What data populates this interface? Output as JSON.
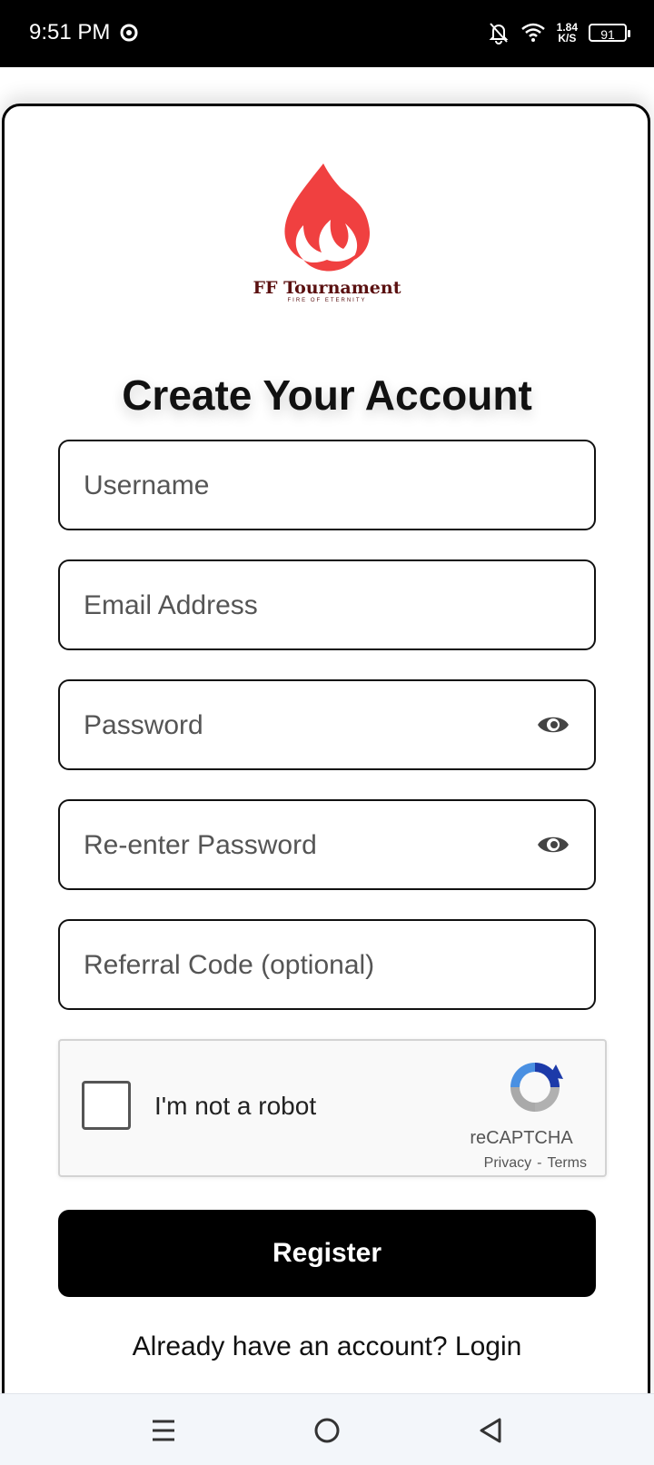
{
  "status_bar": {
    "time": "9:51 PM",
    "speed_value": "1.84",
    "speed_unit": "K/S",
    "battery": "91"
  },
  "brand": {
    "name": "FF Tournament",
    "tagline": "FIRE OF ETERNITY",
    "logo_color": "#f04040",
    "text_color": "#5a1010"
  },
  "title": "Create Your Account",
  "form": {
    "username_placeholder": "Username",
    "email_placeholder": "Email Address",
    "password_placeholder": "Password",
    "confirm_password_placeholder": "Re-enter Password",
    "referral_placeholder": "Referral Code (optional)"
  },
  "recaptcha": {
    "label": "I'm not a robot",
    "brand": "reCAPTCHA",
    "privacy": "Privacy",
    "separator": "-",
    "terms": "Terms"
  },
  "register_label": "Register",
  "login_prompt": "Already have an account?",
  "login_link": "Login",
  "icons": [
    "chrome-icon",
    "bell-off-icon",
    "wifi-icon",
    "battery-icon",
    "eye-icon",
    "recaptcha-logo-icon",
    "menu-icon",
    "home-icon",
    "back-icon"
  ]
}
